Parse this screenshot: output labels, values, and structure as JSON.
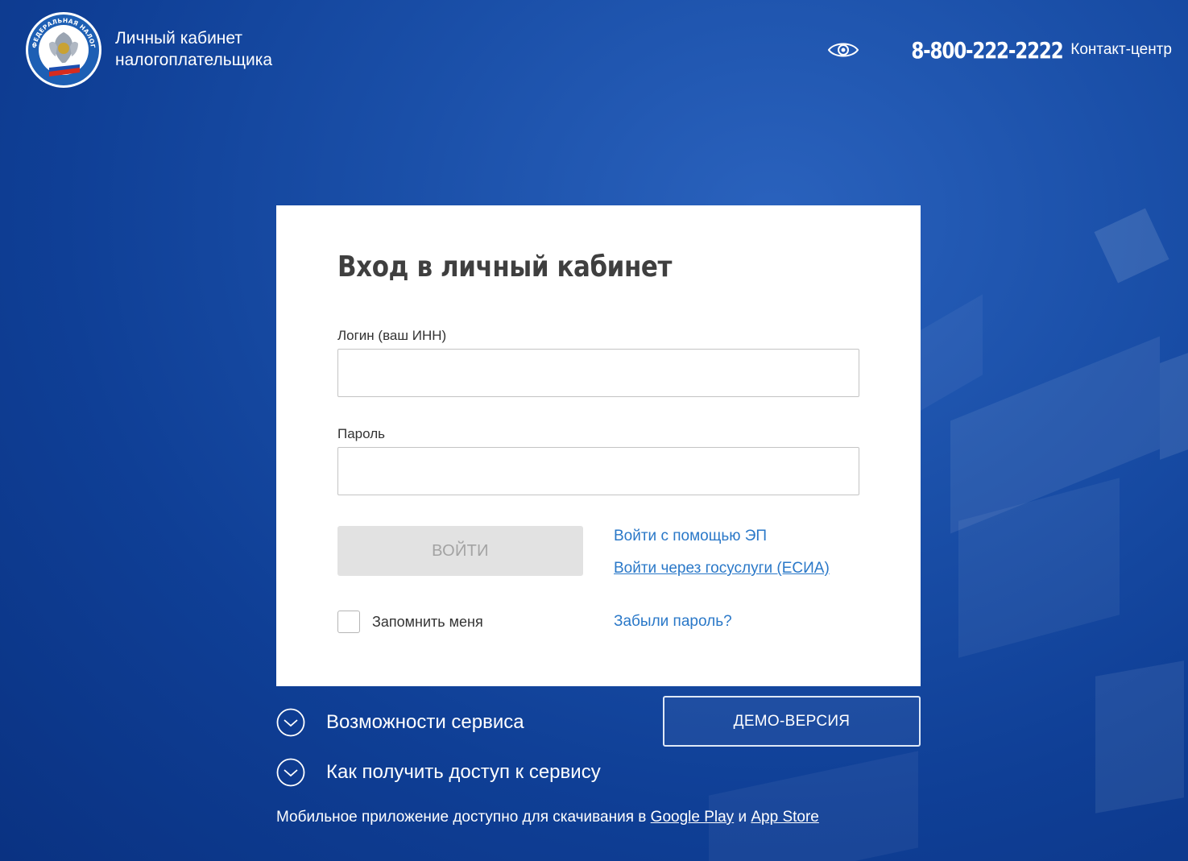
{
  "header": {
    "logo_text": "ФЕДЕРАЛЬНАЯ НАЛОГОВАЯ СЛУЖБА",
    "title_line1": "Личный кабинет",
    "title_line2": "налогоплательщика",
    "phone": "8-800-222-2222",
    "contact_center": "Контакт-центр",
    "accessibility_icon": "eye-icon"
  },
  "login": {
    "title": "Вход в личный кабинет",
    "login_label": "Логин (ваш ИНН)",
    "login_value": "",
    "password_label": "Пароль",
    "password_value": "",
    "submit_label": "ВОЙТИ",
    "submit_state": "disabled",
    "ep_link": "Войти с помощью ЭП",
    "esia_link": "Войти через госуслуги (ЕСИА)",
    "remember_label": "Запомнить меня",
    "remember_checked": false,
    "forgot_link": "Забыли пароль?"
  },
  "info": {
    "features_label": "Возможности сервиса",
    "access_label": "Как получить доступ к сервису",
    "demo_label": "ДЕМО-ВЕРСИЯ",
    "chevron_icon": "chevron-down-icon"
  },
  "footer": {
    "prefix": "Мобильное приложение доступно для скачивания в",
    "google_play": "Google Play",
    "and": "и",
    "app_store": "App Store"
  },
  "colors": {
    "background": "#1a4fa8",
    "link": "#2a78c8",
    "button_disabled_bg": "#e2e2e2",
    "button_disabled_text": "#a3a3a3"
  }
}
